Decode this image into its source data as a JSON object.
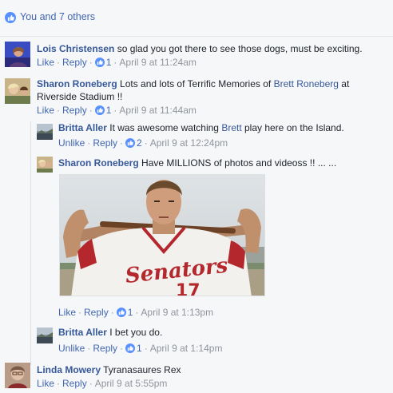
{
  "reactions": {
    "summary": "You and 7 others"
  },
  "comments": [
    {
      "author": "Lois Christensen",
      "text": "so glad you got there to see those dogs, must be exciting.",
      "like": "Like",
      "reply": "Reply",
      "likes": "1",
      "time": "April 9 at 11:24am"
    },
    {
      "author": "Sharon Roneberg",
      "text_a": "Lots and lots of Terrific Memories of ",
      "link": "Brett Roneberg",
      "text_b": " at",
      "text_c": "Riverside Stadium !!",
      "like": "Like",
      "reply": "Reply",
      "likes": "1",
      "time": "April 9 at 11:44am"
    },
    {
      "author": "Britta Aller",
      "text_a": "It was awesome watching ",
      "link": "Brett",
      "text_b": " play here on the Island.",
      "like": "Unlike",
      "reply": "Reply",
      "likes": "2",
      "time": "April 9 at 12:24pm"
    },
    {
      "author": "Sharon Roneberg",
      "text": "Have MILLIONS of photos and videoss !! ... ...",
      "photo_text": "Senators",
      "photo_number": "17",
      "like": "Like",
      "reply": "Reply",
      "likes": "1",
      "time": "April 9 at 1:13pm"
    },
    {
      "author": "Britta Aller",
      "text": "I bet you do.",
      "like": "Unlike",
      "reply": "Reply",
      "likes": "1",
      "time": "April 9 at 1:14pm"
    },
    {
      "author": "Linda Mowery",
      "text": "Tyranasaures Rex",
      "like": "Like",
      "reply": "Reply",
      "time": "April 9 at 5:55pm"
    }
  ],
  "colors": {
    "link": "#365899",
    "meta": "#90949c",
    "like_blue": "#5890ff"
  }
}
